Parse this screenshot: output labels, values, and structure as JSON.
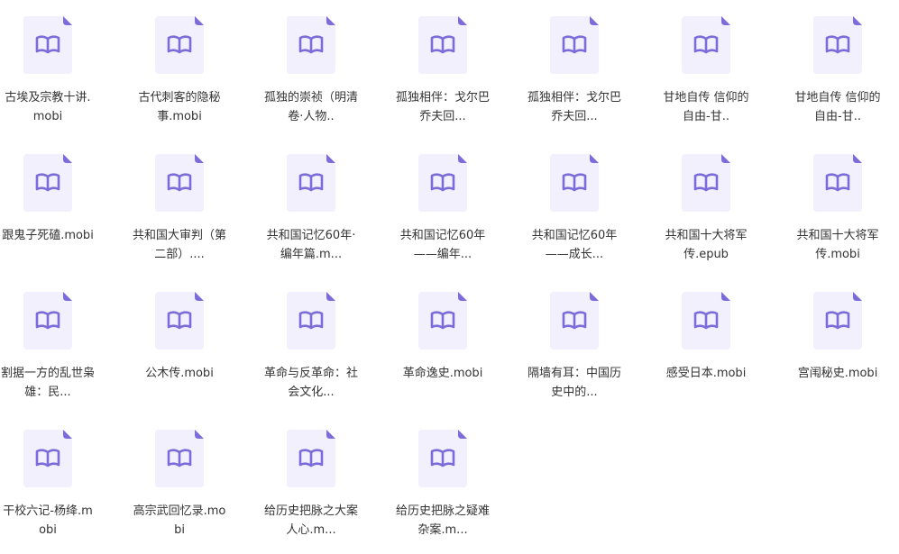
{
  "colors": {
    "doc_bg": "#f2f0fc",
    "doc_fold": "#7b6cd9",
    "book_icon": "#7b6cd9",
    "label_text": "#333333"
  },
  "icon_name": "ebook-file-icon",
  "files": [
    {
      "name": "古埃及宗教十讲.mobi"
    },
    {
      "name": "古代刺客的隐秘事.mobi"
    },
    {
      "name": "孤独的崇祯（明清卷·人物.."
    },
    {
      "name": "孤独相伴：戈尔巴乔夫回..."
    },
    {
      "name": "孤独相伴：戈尔巴乔夫回..."
    },
    {
      "name": "甘地自传 信仰的自由-甘.."
    },
    {
      "name": "甘地自传 信仰的自由-甘.."
    },
    {
      "name": "跟鬼子死磕.mobi"
    },
    {
      "name": "共和国大审判（第二部）...."
    },
    {
      "name": "共和国记忆60年·编年篇.m..."
    },
    {
      "name": "共和国记忆60年——编年..."
    },
    {
      "name": "共和国记忆60年——成长..."
    },
    {
      "name": "共和国十大将军传.epub"
    },
    {
      "name": "共和国十大将军传.mobi"
    },
    {
      "name": "割据一方的乱世枭雄：民..."
    },
    {
      "name": "公木传.mobi"
    },
    {
      "name": "革命与反革命：社会文化..."
    },
    {
      "name": "革命逸史.mobi"
    },
    {
      "name": "隔墙有耳：中国历史中的..."
    },
    {
      "name": "感受日本.mobi"
    },
    {
      "name": "宫闱秘史.mobi"
    },
    {
      "name": "干校六记-杨绛.mobi"
    },
    {
      "name": "高宗武回忆录.mobi"
    },
    {
      "name": "给历史把脉之大案人心.m..."
    },
    {
      "name": "给历史把脉之疑难杂案.m..."
    }
  ]
}
